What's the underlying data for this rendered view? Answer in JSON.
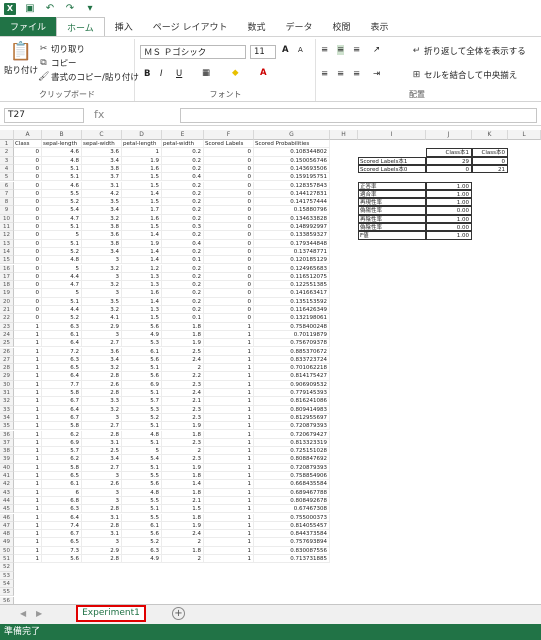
{
  "app": {
    "window_icon": "excel-icon",
    "status": "準備完了",
    "sheet_tab": "Experiment1",
    "namebox": "T27",
    "fx": "fx"
  },
  "tabs": [
    "ファイル",
    "ホーム",
    "挿入",
    "ページ レイアウト",
    "数式",
    "データ",
    "校閲",
    "表示"
  ],
  "ribbon": {
    "paste": "貼り付け",
    "cut": "切り取り",
    "copy": "コピー",
    "format_painter": "書式のコピー/貼り付け",
    "clipboard": "クリップボード",
    "font_name": "ＭＳ Ｐゴシック",
    "font_size": "11",
    "font": "フォント",
    "wrap": "折り返して全体を表示する",
    "merge": "セルを結合して中央揃え",
    "alignment": "配置",
    "bold": "B",
    "italic": "I",
    "underline": "U",
    "grow": "A",
    "shrink": "A"
  },
  "columns": [
    "A",
    "B",
    "C",
    "D",
    "E",
    "F",
    "G",
    "H",
    "I",
    "J",
    "K",
    "L"
  ],
  "headers": [
    "Class",
    "sepal-length",
    "sepal-width",
    "petal-length",
    "petal-width",
    "Scored Labels",
    "Scored Probabilities"
  ],
  "rows": [
    [
      "0",
      "4.6",
      "3.6",
      "1",
      "0.2",
      "0",
      "0.108344802"
    ],
    [
      "0",
      "4.8",
      "3.4",
      "1.9",
      "0.2",
      "0",
      "0.150056746"
    ],
    [
      "0",
      "5.1",
      "3.8",
      "1.6",
      "0.2",
      "0",
      "0.143693506"
    ],
    [
      "0",
      "5.1",
      "3.7",
      "1.5",
      "0.4",
      "0",
      "0.159195751"
    ],
    [
      "0",
      "4.6",
      "3.1",
      "1.5",
      "0.2",
      "0",
      "0.128357843"
    ],
    [
      "0",
      "5.5",
      "4.2",
      "1.4",
      "0.2",
      "0",
      "0.144127831"
    ],
    [
      "0",
      "5.2",
      "3.5",
      "1.5",
      "0.2",
      "0",
      "0.141757444"
    ],
    [
      "0",
      "5.4",
      "3.4",
      "1.7",
      "0.2",
      "0",
      "0.15880796"
    ],
    [
      "0",
      "4.7",
      "3.2",
      "1.6",
      "0.2",
      "0",
      "0.134633828"
    ],
    [
      "0",
      "5.1",
      "3.8",
      "1.5",
      "0.3",
      "0",
      "0.148992997"
    ],
    [
      "0",
      "5",
      "3.6",
      "1.4",
      "0.2",
      "0",
      "0.133859327"
    ],
    [
      "0",
      "5.1",
      "3.8",
      "1.9",
      "0.4",
      "0",
      "0.179344848"
    ],
    [
      "0",
      "5.2",
      "3.4",
      "1.4",
      "0.2",
      "0",
      "0.13748771"
    ],
    [
      "0",
      "4.8",
      "3",
      "1.4",
      "0.1",
      "0",
      "0.120185129"
    ],
    [
      "0",
      "5",
      "3.2",
      "1.2",
      "0.2",
      "0",
      "0.124965683"
    ],
    [
      "0",
      "4.4",
      "3",
      "1.3",
      "0.2",
      "0",
      "0.116512075"
    ],
    [
      "0",
      "4.7",
      "3.2",
      "1.3",
      "0.2",
      "0",
      "0.122551385"
    ],
    [
      "0",
      "5",
      "3",
      "1.6",
      "0.2",
      "0",
      "0.141663417"
    ],
    [
      "0",
      "5.1",
      "3.5",
      "1.4",
      "0.2",
      "0",
      "0.135153592"
    ],
    [
      "0",
      "4.4",
      "3.2",
      "1.3",
      "0.2",
      "0",
      "0.116426349"
    ],
    [
      "0",
      "5.2",
      "4.1",
      "1.5",
      "0.1",
      "0",
      "0.132198061"
    ],
    [
      "1",
      "6.3",
      "2.9",
      "5.6",
      "1.8",
      "1",
      "0.758400248"
    ],
    [
      "1",
      "6.1",
      "3",
      "4.9",
      "1.8",
      "1",
      "0.70119879"
    ],
    [
      "1",
      "6.4",
      "2.7",
      "5.3",
      "1.9",
      "1",
      "0.756709378"
    ],
    [
      "1",
      "7.2",
      "3.6",
      "6.1",
      "2.5",
      "1",
      "0.885370672"
    ],
    [
      "1",
      "6.3",
      "3.4",
      "5.6",
      "2.4",
      "1",
      "0.833723724"
    ],
    [
      "1",
      "6.5",
      "3.2",
      "5.1",
      "2",
      "1",
      "0.701062218"
    ],
    [
      "1",
      "6.4",
      "2.8",
      "5.6",
      "2.2",
      "1",
      "0.814175427"
    ],
    [
      "1",
      "7.7",
      "2.6",
      "6.9",
      "2.3",
      "1",
      "0.906909532"
    ],
    [
      "1",
      "5.8",
      "2.8",
      "5.1",
      "2.4",
      "1",
      "0.779145393"
    ],
    [
      "1",
      "6.7",
      "3.3",
      "5.7",
      "2.1",
      "1",
      "0.816241086"
    ],
    [
      "1",
      "6.4",
      "3.2",
      "5.3",
      "2.3",
      "1",
      "0.809414983"
    ],
    [
      "1",
      "6.7",
      "3",
      "5.2",
      "2.3",
      "1",
      "0.812955697"
    ],
    [
      "1",
      "5.8",
      "2.7",
      "5.1",
      "1.9",
      "1",
      "0.720879393"
    ],
    [
      "1",
      "6.2",
      "2.8",
      "4.8",
      "1.8",
      "1",
      "0.720679427"
    ],
    [
      "1",
      "6.9",
      "3.1",
      "5.1",
      "2.3",
      "1",
      "0.813323319"
    ],
    [
      "1",
      "5.7",
      "2.5",
      "5",
      "2",
      "1",
      "0.725151028"
    ],
    [
      "1",
      "6.2",
      "3.4",
      "5.4",
      "2.3",
      "1",
      "0.808847692"
    ],
    [
      "1",
      "5.8",
      "2.7",
      "5.1",
      "1.9",
      "1",
      "0.720879393"
    ],
    [
      "1",
      "6.5",
      "3",
      "5.5",
      "1.8",
      "1",
      "0.758854906"
    ],
    [
      "1",
      "6.1",
      "2.6",
      "5.6",
      "1.4",
      "1",
      "0.668435584"
    ],
    [
      "1",
      "6",
      "3",
      "4.8",
      "1.8",
      "1",
      "0.689467788"
    ],
    [
      "1",
      "6.8",
      "3",
      "5.5",
      "2.1",
      "1",
      "0.808492678"
    ],
    [
      "1",
      "6.3",
      "2.8",
      "5.1",
      "1.5",
      "1",
      "0.67467308"
    ],
    [
      "1",
      "6.4",
      "3.1",
      "5.5",
      "1.8",
      "1",
      "0.755000373"
    ],
    [
      "1",
      "7.4",
      "2.8",
      "6.1",
      "1.9",
      "1",
      "0.814055457"
    ],
    [
      "1",
      "6.7",
      "3.1",
      "5.6",
      "2.4",
      "1",
      "0.844373584"
    ],
    [
      "1",
      "6.5",
      "3",
      "5.2",
      "2",
      "1",
      "0.757693894"
    ],
    [
      "1",
      "7.3",
      "2.9",
      "6.3",
      "1.8",
      "1",
      "0.830087556"
    ],
    [
      "1",
      "5.6",
      "2.8",
      "4.9",
      "2",
      "1",
      "0.713731885"
    ]
  ],
  "confusion": {
    "h1": "Class本1",
    "h2": "Class本0",
    "r1": "Scored Labels本1",
    "r2": "Scored Labels本0",
    "v11": "29",
    "v12": "0",
    "v21": "0",
    "v22": "21"
  },
  "metrics": [
    [
      "正答率",
      "1.00"
    ],
    [
      "適合率",
      "1.00"
    ],
    [
      "再現性率",
      "1.00"
    ],
    [
      "偽陽性率",
      "0.00"
    ],
    [
      "再陰性率",
      "1.00"
    ],
    [
      "偽陰性率",
      "0.00"
    ],
    [
      "F値",
      "1.00"
    ]
  ]
}
